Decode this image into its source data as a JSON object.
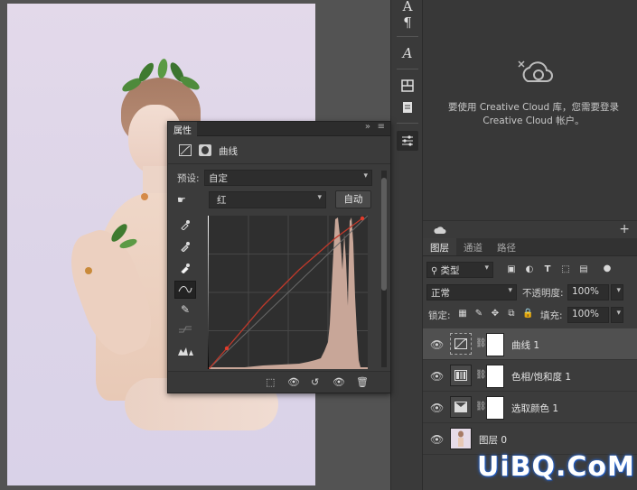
{
  "properties_panel": {
    "tab_label": "属性",
    "collapse_glyph": "»",
    "menu_glyph": "≡",
    "adjustment_title": "曲线",
    "preset_label": "预设:",
    "preset_value": "自定",
    "channel_value": "红",
    "auto_button": "自动",
    "curve_color": "#c0392b",
    "histogram_color": "#c8a698"
  },
  "libraries_panel": {
    "message": "要使用 Creative Cloud 库，您需要登录 Creative Cloud 帐户。"
  },
  "layers_panel": {
    "tabs": [
      {
        "label": "图层",
        "active": true
      },
      {
        "label": "通道",
        "active": false
      },
      {
        "label": "路径",
        "active": false
      }
    ],
    "filter_value": "类型",
    "blend_mode": "正常",
    "opacity_label": "不透明度:",
    "opacity_value": "100%",
    "lock_label": "锁定:",
    "fill_label": "填充:",
    "fill_value": "100%",
    "layers": [
      {
        "name": "曲线 1",
        "icon": "curves-icon",
        "selected": true,
        "has_mask": true
      },
      {
        "name": "色相/饱和度 1",
        "icon": "hue-saturation-icon",
        "selected": false,
        "has_mask": true
      },
      {
        "name": "选取颜色 1",
        "icon": "selective-color-icon",
        "selected": false,
        "has_mask": true
      },
      {
        "name": "图层 0",
        "icon": "photo-thumbnail",
        "selected": false,
        "has_mask": false
      }
    ]
  },
  "watermark": "UiBQ.CoM"
}
